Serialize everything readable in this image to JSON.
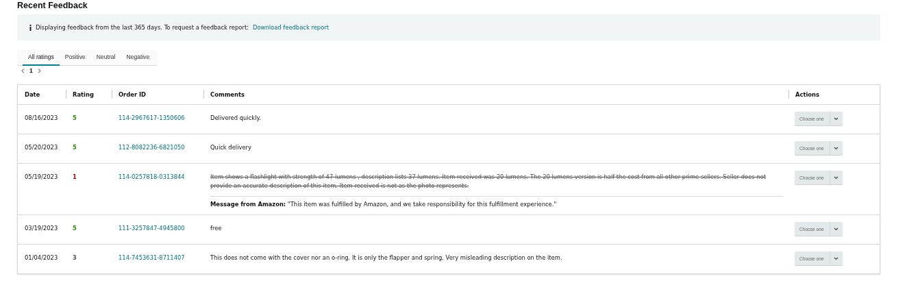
{
  "title": "Recent Feedback",
  "notice": {
    "text": "Displaying feedback from the last 365 days. To request a feedback report:",
    "link": "Download feedback report"
  },
  "tabs": [
    {
      "label": "All ratings",
      "selected": true
    },
    {
      "label": "Positive",
      "selected": false
    },
    {
      "label": "Neutral",
      "selected": false
    },
    {
      "label": "Negative",
      "selected": false
    }
  ],
  "pagination": {
    "page": "1"
  },
  "table": {
    "columns": [
      "Date",
      "Rating",
      "Order ID",
      "Comments",
      "Actions"
    ],
    "rows": [
      {
        "date": "08/16/2023",
        "rating": "5",
        "color": "#2a8c00",
        "order_id": "114-2967617-1350606",
        "comment": "Delivered quickly.",
        "struck": false,
        "action": "Choose one"
      },
      {
        "date": "05/20/2023",
        "rating": "5",
        "color": "#2a8c00",
        "order_id": "112-8082236-6821050",
        "comment": "Quick delivery",
        "struck": false,
        "action": "Choose one"
      },
      {
        "date": "05/19/2023",
        "rating": "1",
        "color": "#b30000",
        "order_id": "114-0257818-0313844",
        "comment": "Item shows a flashlight with strength of 47 lumens , description lists 37 lumens. Item received was 20 lumens. The 20 lumens version is half the cost from all other prime sellers. Seller does not provide an accurate description of this item. Item received is not as the photo represents.",
        "struck": true,
        "message": "**Message from Amazon:** \"This item was fulfilled by Amazon, and we take responsibility for this fulfillment experience.\"",
        "action": "Choose one"
      },
      {
        "date": "03/19/2023",
        "rating": "5",
        "color": "#2a8c00",
        "order_id": "111-3257847-4945800",
        "comment": "free",
        "struck": false,
        "action": "Choose one"
      },
      {
        "date": "01/04/2023",
        "rating": "3",
        "color": "#555555",
        "order_id": "114-7453631-8711407",
        "comment": "This does not come with the cover nor an o-ring. It is only the flapper and spring. Very misleading description on the item.",
        "struck": false,
        "action": "Choose one"
      }
    ]
  }
}
